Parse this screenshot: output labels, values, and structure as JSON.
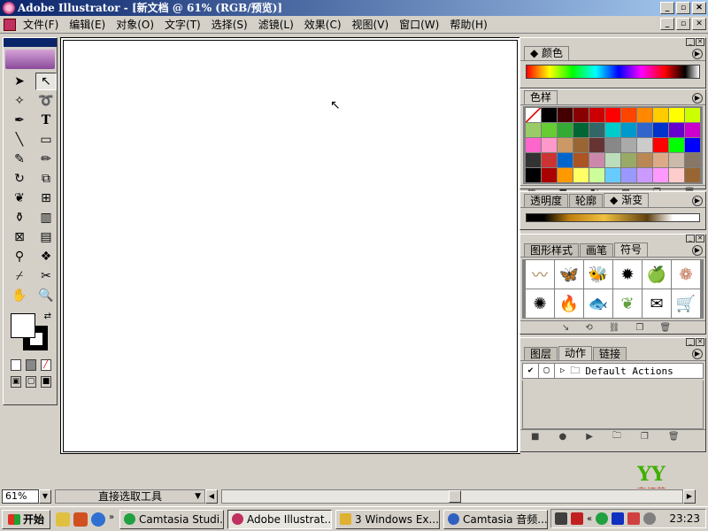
{
  "window": {
    "title": "Adobe Illustrator - [新文档 @ 61% (RGB/预览)]"
  },
  "menu": [
    "文件(F)",
    "编辑(E)",
    "对象(O)",
    "文字(T)",
    "选择(S)",
    "滤镜(L)",
    "效果(C)",
    "视图(V)",
    "窗口(W)",
    "帮助(H)"
  ],
  "panels": {
    "color": {
      "tab": "颜色"
    },
    "swatches": {
      "tab": "色样"
    },
    "transparency": {
      "tabs": [
        "透明度",
        "轮廓",
        "渐变"
      ]
    },
    "graphic_styles": {
      "tabs": [
        "图形样式",
        "画笔",
        "符号"
      ]
    },
    "layers": {
      "tabs": [
        "图层",
        "动作",
        "链接"
      ],
      "action_set": "Default Actions"
    }
  },
  "colors": {
    "accent": "#0a246a",
    "face": "#d4d0c8"
  },
  "status": {
    "zoom": "61%",
    "tool": "直接选取工具"
  },
  "logo": {
    "text": "育绿苑"
  },
  "taskbar": {
    "start": "开始",
    "buttons": [
      "Camtasia Studi...",
      "Adobe Illustrat...",
      "3 Windows Ex...",
      "Camtasia 音频..."
    ],
    "clock": "23:23"
  }
}
